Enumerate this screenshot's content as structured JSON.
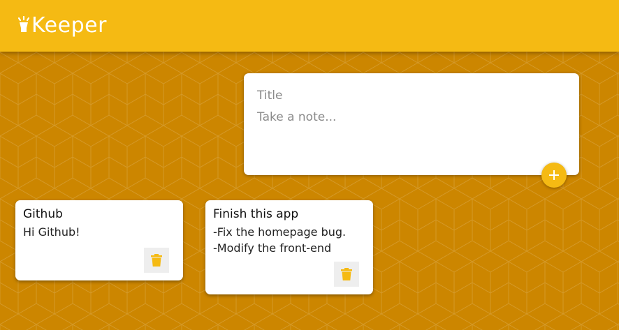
{
  "colors": {
    "brand": "#f5ba13",
    "background": "#cc8600"
  },
  "header": {
    "title": "Keeper",
    "logo_icon": "lightbulb-icon"
  },
  "compose": {
    "title_placeholder": "Title",
    "content_placeholder": "Take a note...",
    "add_icon": "plus-icon"
  },
  "notes": [
    {
      "title": "Github",
      "content": "Hi Github!",
      "delete_icon": "trash-icon"
    },
    {
      "title": "Finish this app",
      "content": "-Fix the homepage bug.\n-Modify the front-end",
      "delete_icon": "trash-icon"
    }
  ]
}
